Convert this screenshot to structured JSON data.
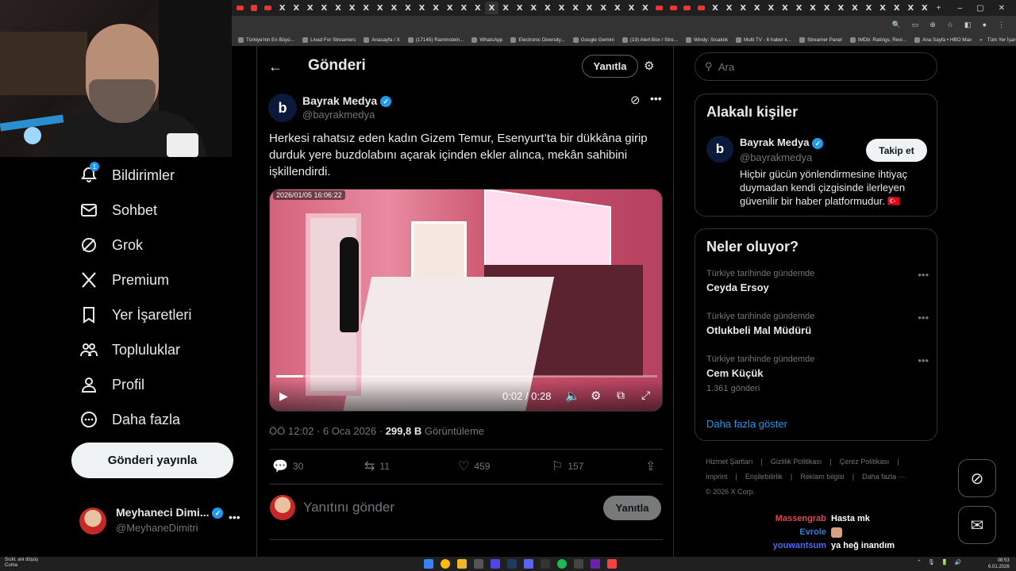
{
  "browser": {
    "tabs": [
      "yt",
      "red",
      "yt",
      "x",
      "x",
      "x",
      "x",
      "x",
      "x",
      "x",
      "x",
      "x",
      "x",
      "x",
      "x",
      "x",
      "x",
      "x",
      "x",
      "x",
      "x",
      "x",
      "x",
      "x",
      "x",
      "x",
      "x",
      "x",
      "x",
      "x",
      "yt",
      "yt",
      "yt",
      "yt",
      "x",
      "x",
      "x",
      "x",
      "x",
      "x",
      "x",
      "x",
      "x",
      "x",
      "x",
      "x",
      "x",
      "x",
      "x",
      "x"
    ],
    "new_tab": "+",
    "bookmarks": [
      "Türkiye'nin En Büyü...",
      "Livad For Streamers",
      "Anasayfa / X",
      "(17145) Rammstein...",
      "WhatsApp",
      "Electronic Diversity...",
      "Google Gemini",
      "(19) Alert Box / Stre...",
      "Windy: Sıcaklık",
      "Multi TV - 6 haber k...",
      "Streamer Panel",
      "IMDb: Ratings, Revi...",
      "Ana Sayfa • HBO Max"
    ],
    "bookmarks_more": "»",
    "bookmarks_all": "Tüm Yer İşaretleri"
  },
  "nav": {
    "items": [
      {
        "label": "Bildirimler",
        "icon": "bell-icon",
        "badge": "1"
      },
      {
        "label": "Sohbet",
        "icon": "mail-icon"
      },
      {
        "label": "Grok",
        "icon": "grok-icon"
      },
      {
        "label": "Premium",
        "icon": "x-logo-icon"
      },
      {
        "label": "Yer İşaretleri",
        "icon": "bookmark-icon"
      },
      {
        "label": "Topluluklar",
        "icon": "people-icon"
      },
      {
        "label": "Profil",
        "icon": "person-icon"
      },
      {
        "label": "Daha fazla",
        "icon": "more-circle-icon"
      }
    ],
    "post_button": "Gönderi yayınla",
    "user": {
      "name": "Meyhaneci Dimi...",
      "handle": "@MeyhaneDimitri",
      "more": "•••"
    }
  },
  "post": {
    "header_title": "Gönderi",
    "reply_header_btn": "Yanıtla",
    "author_name": "Bayrak Medya",
    "author_handle": "@bayrakmedya",
    "avatar_letter": "b",
    "text": "Herkesi rahatsız eden kadın Gizem Temur, Esenyurt’ta bir dükkâna girip durduk yere buzdolabını açarak içinden ekler alınca, mekân sahibini işkillendirdi.",
    "video": {
      "timestamp": "2026/01/05 16:06:22",
      "time": "0:02 / 0:28",
      "progress": 0.07
    },
    "time": "ÖÖ 12:02 · 6 Oca 2026 · ",
    "views": "299,8 B",
    "views_label": " Görüntüleme",
    "stats": {
      "replies": "30",
      "reposts": "11",
      "likes": "459",
      "bookmarks": "157"
    },
    "reply_placeholder": "Yanıtını gönder",
    "reply_button": "Yanıtla"
  },
  "sidebar": {
    "search_placeholder": "Ara",
    "related_title": "Alakalı kişiler",
    "related": {
      "name": "Bayrak Medya",
      "handle": "@bayrakmedya",
      "avatar_letter": "b",
      "follow": "Takip et",
      "bio": "Hiçbir gücün yönlendirmesine ihtiyaç duymadan kendi çizgisinde ilerleyen güvenilir bir haber platformudur. 🇹🇷"
    },
    "trends_title": "Neler oluyor?",
    "trends": [
      {
        "context": "Türkiye tarihinde gündemde",
        "title": "Ceyda Ersoy",
        "count": ""
      },
      {
        "context": "Türkiye tarihinde gündemde",
        "title": "Otlukbeli Mal Müdürü",
        "count": ""
      },
      {
        "context": "Türkiye tarihinde gündemde",
        "title": "Cem Küçük",
        "count": "1.361 gönderi"
      }
    ],
    "show_more": "Daha fazla göster",
    "footer": [
      "Hizmet Şartları",
      "|",
      "Gizlilik Politikası",
      "|",
      "Çerez Politikası",
      "|",
      "Imprint",
      "|",
      "Erişilebilirlik",
      "|",
      "Reklam bilgisi",
      "|",
      "Daha fazla ···",
      "© 2026 X Corp."
    ]
  },
  "chat": [
    {
      "user": "Massengrab",
      "color": "#e0484f",
      "msg": "Hasta mk"
    },
    {
      "user": "Evrole",
      "color": "#3a7bd5",
      "msg": ""
    },
    {
      "user": "youwantsum",
      "color": "#4a6cf7",
      "msg": "ya heğ inandım"
    }
  ],
  "taskbar": {
    "weather_line1": "Sıckl. ani düşüş",
    "weather_line2": "Cuma",
    "clock_time": "08:53",
    "clock_date": "6.01.2026"
  },
  "colors": {
    "accent": "#1d9bf0",
    "bg": "#000000",
    "border": "#2f3336",
    "muted": "#71767b"
  }
}
